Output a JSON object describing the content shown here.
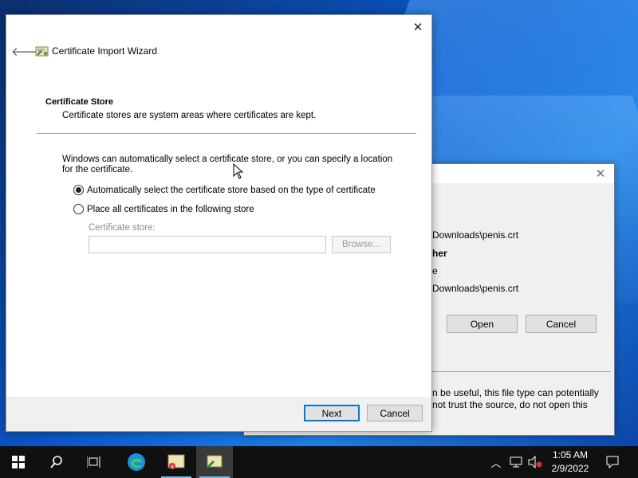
{
  "wizard": {
    "title": "Certificate Import Wizard",
    "section_heading": "Certificate Store",
    "section_subtitle": "Certificate stores are system areas where certificates are kept.",
    "description": "Windows can automatically select a certificate store, or you can specify a location for the certificate.",
    "radio_auto_label": "Automatically select the certificate store based on the type of certificate",
    "radio_auto_checked": true,
    "radio_place_label": "Place all certificates in the following store",
    "radio_place_checked": false,
    "store_label": "Certificate store:",
    "store_value": "",
    "browse_label": "Browse...",
    "next_label": "Next",
    "cancel_label": "Cancel",
    "close_icon": "close-icon",
    "back_icon": "back-arrow-icon"
  },
  "background_dialog": {
    "line1": "Downloads\\penis.crt",
    "line2": "her",
    "line3": "e",
    "line4": "Downloads\\penis.crt",
    "open_label": "Open",
    "cancel_label": "Cancel",
    "warning_line1": "n be useful, this file type can potentially",
    "warning_line2": "not trust the source, do not open this"
  },
  "taskbar": {
    "time": "1:05 AM",
    "date": "2/9/2022",
    "icons": [
      "windows-start-icon",
      "search-icon",
      "task-view-icon",
      "edge-icon",
      "certificate-app-icon",
      "certificate-wizard-icon"
    ],
    "tray_icons": [
      "chevron-up-icon",
      "network-icon",
      "volume-muted-icon",
      "notifications-icon"
    ]
  },
  "colors": {
    "accent": "#0078d7",
    "taskbar": "#101010",
    "dialog_bg": "#f0f0f0"
  }
}
